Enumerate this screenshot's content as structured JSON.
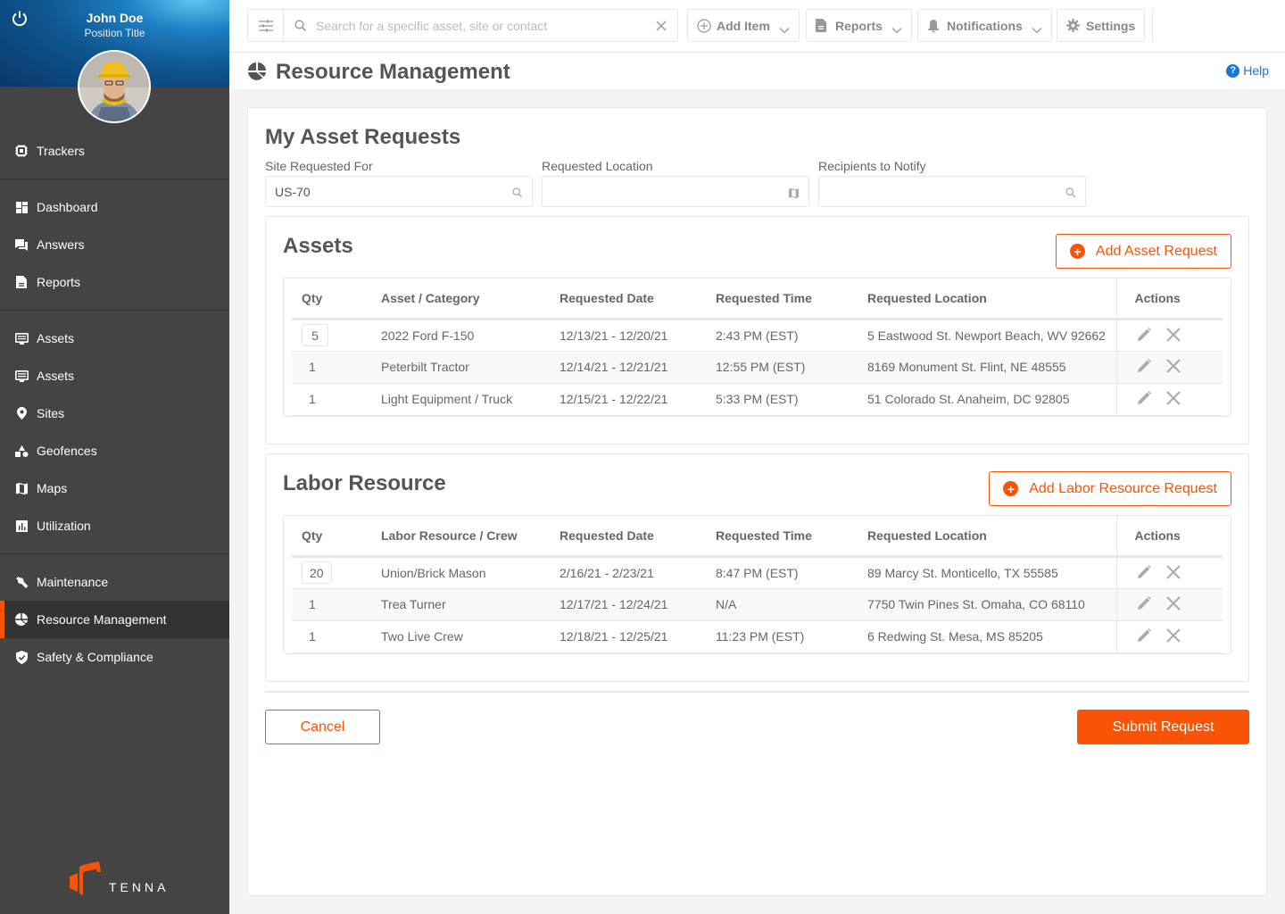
{
  "user": {
    "name": "John Doe",
    "title": "Position Title"
  },
  "sidebar": {
    "groups": [
      [
        {
          "label": "Trackers",
          "icon": "tracker-chip-icon"
        }
      ],
      [
        {
          "label": "Dashboard",
          "icon": "dashboard-icon"
        },
        {
          "label": "Answers",
          "icon": "chat-icon"
        },
        {
          "label": "Reports",
          "icon": "document-icon"
        }
      ],
      [
        {
          "label": "Assets",
          "icon": "monitor-icon"
        },
        {
          "label": "Assets",
          "icon": "monitor-icon"
        },
        {
          "label": "Sites",
          "icon": "map-pin-icon"
        },
        {
          "label": "Geofences",
          "icon": "shapes-icon"
        },
        {
          "label": "Maps",
          "icon": "map-icon"
        },
        {
          "label": "Utilization",
          "icon": "bar-chart-icon"
        }
      ],
      [
        {
          "label": "Maintenance",
          "icon": "wrench-icon"
        },
        {
          "label": "Resource Management",
          "icon": "pie-chart-icon",
          "active": true
        },
        {
          "label": "Safety & Compliance",
          "icon": "shield-check-icon"
        }
      ]
    ],
    "logo_text": "TENNA"
  },
  "topbar": {
    "search_placeholder": "Search for a specific asset, site or contact",
    "search_value": "",
    "buttons": {
      "add_item": "Add Item",
      "reports": "Reports",
      "notifications": "Notifications",
      "settings": "Settings"
    }
  },
  "page": {
    "title": "Resource Management",
    "help": "Help"
  },
  "form": {
    "title": "My Asset Requests",
    "fields": {
      "site": {
        "label": "Site Requested For",
        "value": "US-70"
      },
      "location": {
        "label": "Requested Location",
        "value": ""
      },
      "recipients": {
        "label": "Recipients to Notify",
        "value": ""
      }
    }
  },
  "assets": {
    "title": "Assets",
    "add_label": "Add Asset Request",
    "columns": [
      "Qty",
      "Asset / Category",
      "Requested Date",
      "Requested Time",
      "Requested Location",
      "Actions"
    ],
    "rows": [
      {
        "qty": "5",
        "name": "2022 Ford F-150",
        "date": "12/13/21 - 12/20/21",
        "time": "2:43 PM (EST)",
        "location": "5 Eastwood St. Newport Beach, WV 92662"
      },
      {
        "qty": "1",
        "name": "Peterbilt Tractor",
        "date": "12/14/21 - 12/21/21",
        "time": "12:55 PM (EST)",
        "location": "8169 Monument St. Flint, NE 48555"
      },
      {
        "qty": "1",
        "name": "Light Equipment / Truck",
        "date": "12/15/21 - 12/22/21",
        "time": "5:33 PM (EST)",
        "location": "51 Colorado St. Anaheim, DC 92805"
      }
    ]
  },
  "labor": {
    "title": "Labor Resource",
    "add_label": "Add Labor Resource Request",
    "columns": [
      "Qty",
      "Labor Resource / Crew",
      "Requested Date",
      "Requested Time",
      "Requested Location",
      "Actions"
    ],
    "rows": [
      {
        "qty": "20",
        "name": "Union/Brick Mason",
        "date": "2/16/21 - 2/23/21",
        "time": "8:47 PM (EST)",
        "location": "89 Marcy St. Monticello, TX 55585"
      },
      {
        "qty": "1",
        "name": "Trea Turner",
        "date": "12/17/21 - 12/24/21",
        "time": "N/A",
        "location": "7750 Twin Pines St. Omaha, CO 68110"
      },
      {
        "qty": "1",
        "name": "Two Live Crew",
        "date": "12/18/21 - 12/25/21",
        "time": "11:23 PM (EST)",
        "location": "6 Redwing St. Mesa, MS 85205"
      }
    ]
  },
  "footer": {
    "cancel": "Cancel",
    "submit": "Submit Request"
  },
  "colors": {
    "accent": "#fa5305",
    "sidebar": "#444444",
    "link": "#1e73d6"
  }
}
